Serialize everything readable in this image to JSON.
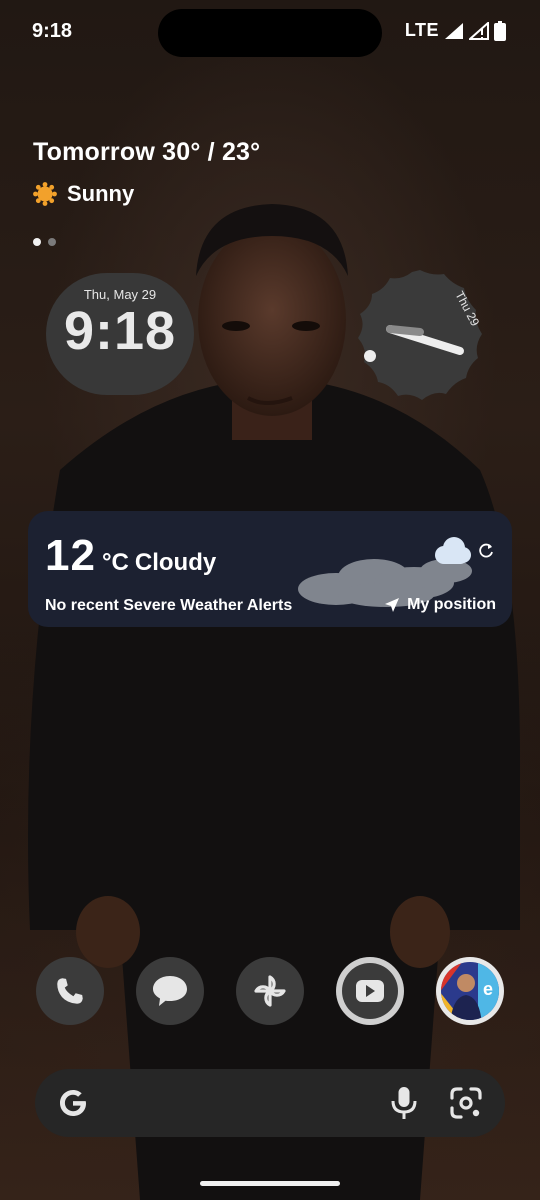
{
  "status_bar": {
    "time": "9:18",
    "network": "LTE",
    "icons": [
      "signal-icon",
      "signal-no-data-icon",
      "battery-icon"
    ]
  },
  "glance": {
    "forecast": "Tomorrow 30° / 23°",
    "condition": "Sunny",
    "condition_icon": "sun-icon",
    "pages": 2,
    "active_page": 1
  },
  "clock_widget": {
    "date": "Thu, May 29",
    "time": "9:18"
  },
  "analog_clock": {
    "date_label": "Thu 29"
  },
  "weather_widget": {
    "temperature": "12",
    "unit": "°C",
    "condition": "Cloudy",
    "alert": "No recent Severe Weather Alerts",
    "location_label": "My position",
    "background": "#1c2131"
  },
  "dock": {
    "apps": [
      {
        "name": "Phone",
        "icon": "phone-icon"
      },
      {
        "name": "Messages",
        "icon": "messages-icon"
      },
      {
        "name": "Photos",
        "icon": "pinwheel-icon"
      },
      {
        "name": "YouTube",
        "icon": "youtube-icon"
      },
      {
        "name": "Football game",
        "icon": "game-avatar-icon"
      }
    ]
  },
  "search": {
    "icons": [
      "google-g-icon",
      "microphone-icon",
      "lens-icon"
    ]
  },
  "colors": {
    "widget_gray": "#383838",
    "dock_gray": "#3b3b3b",
    "search_bg": "#262626"
  }
}
